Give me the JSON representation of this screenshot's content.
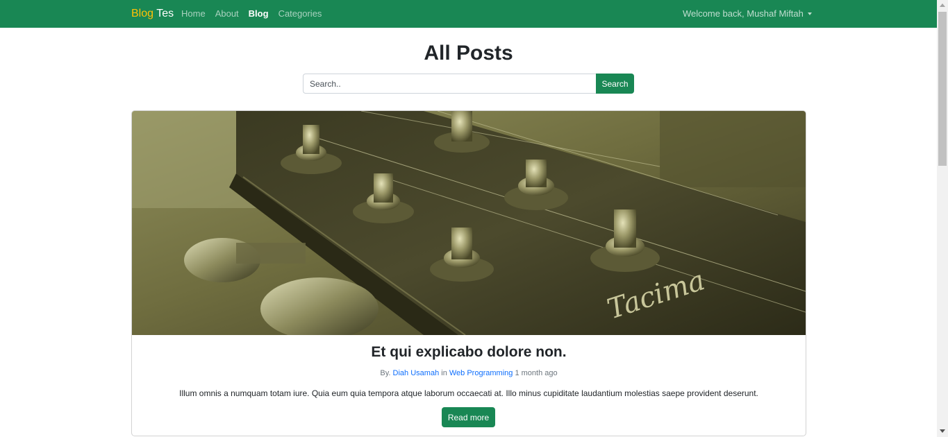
{
  "navbar": {
    "brand_part1": "Blog",
    "brand_part2": "Tes",
    "links": [
      {
        "label": "Home",
        "active": false
      },
      {
        "label": "About",
        "active": false
      },
      {
        "label": "Blog",
        "active": true
      },
      {
        "label": "Categories",
        "active": false
      }
    ],
    "user_menu": "Welcome back, Mushaf Miftah",
    "bg_color": "#198754",
    "brand_accent": "#ffc107"
  },
  "page": {
    "title": "All Posts"
  },
  "search": {
    "placeholder": "Search..",
    "button_label": "Search"
  },
  "post": {
    "title": "Et qui explicabo dolore non.",
    "meta_prefix": "By.",
    "author": "Diah Usamah",
    "meta_in": "in",
    "category": "Web Programming",
    "time": "1 month ago",
    "excerpt": "Illum omnis a numquam totam iure. Quia eum quia tempora atque laborum occaecati at. Illo minus cupiditate laudantium molestias saepe provident deserunt.",
    "read_more": "Read more",
    "image_subject": "guitar-headstock-photo",
    "image_logo_text": "Tacima"
  }
}
